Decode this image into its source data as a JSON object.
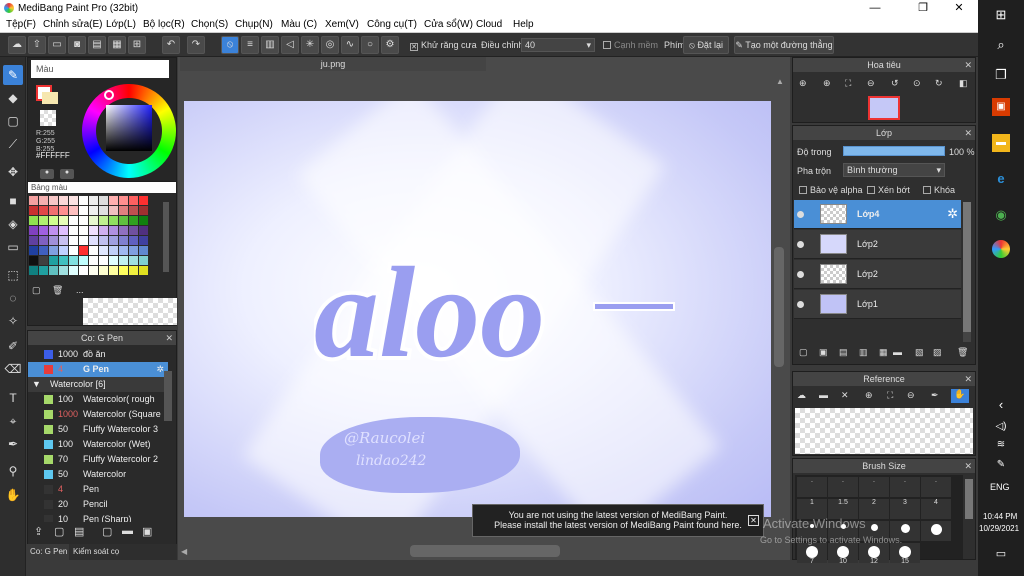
{
  "window": {
    "title": "MediBang Paint Pro (32bit)",
    "min": "—",
    "max": "❐",
    "close": "✕"
  },
  "menu": [
    "Tệp(F)",
    "Chỉnh sửa(E)",
    "Lớp(L)",
    "Bộ lọc(R)",
    "Chọn(S)",
    "Chụp(N)",
    "Màu (C)",
    "Xem(V)",
    "Công cụ(T)",
    "Cửa sổ(W)",
    "Cloud",
    "Help"
  ],
  "toolbar": {
    "antialias": "Khử răng cưa",
    "correction": "Điều chỉnh",
    "correction_value": "40",
    "soft_edge": "Cạnh mềm",
    "key": "Phím",
    "reset": "Đặt lại",
    "straight": "Tạo một đường thẳng"
  },
  "color_panel": {
    "title": "Màu",
    "r": "R:255",
    "g": "G:255",
    "b": "B:255",
    "hex": "#FFFFFF",
    "palette_title": "Bảng màu",
    "palette_more": "..."
  },
  "canvas": {
    "tab": "ju.png",
    "art_text": "aloo",
    "signature_line1": "@Raucolei",
    "signature_line2": "lindao242"
  },
  "brush_list": {
    "title": "Co: G Pen",
    "rows": [
      {
        "size": "1000",
        "name": "đồ ăn",
        "color": "#3c5ee8",
        "sel": false
      },
      {
        "size": "4",
        "name": "G Pen",
        "color": "#e63c3c",
        "sel": true
      },
      {
        "group": "Watercolor [6]"
      },
      {
        "size": "100",
        "name": "Watercolor( rough",
        "color": "#a6d96a"
      },
      {
        "size": "1000",
        "name": "Watercolor (Square",
        "color": "#a6d96a"
      },
      {
        "size": "50",
        "name": "Fluffy Watercolor 3",
        "color": "#a6d96a"
      },
      {
        "size": "100",
        "name": "Watercolor (Wet)",
        "color": "#5ec8f0"
      },
      {
        "size": "70",
        "name": "Fluffy Watercolor 2",
        "color": "#a6d96a"
      },
      {
        "size": "50",
        "name": "Watercolor",
        "color": "#5ec8f0"
      },
      {
        "size": "4",
        "name": "Pen",
        "color": "#333"
      },
      {
        "size": "20",
        "name": "Pencil",
        "color": "#333"
      },
      {
        "size": "10",
        "name": "Pen (Sharp)",
        "color": "#333"
      }
    ],
    "tab1": "Co: G Pen",
    "tab2": "Kiểm soát cọ"
  },
  "navigator": {
    "title": "Hoa tiêu"
  },
  "layers": {
    "title": "Lớp",
    "opacity_label": "Độ trong",
    "opacity_value": "100 %",
    "blend_label": "Pha trộn",
    "blend_value": "Bình thường",
    "protect_alpha": "Bảo vệ alpha",
    "clipping": "Xén bớt",
    "lock": "Khóa",
    "items": [
      {
        "name": "Lớp4",
        "sel": true
      },
      {
        "name": "Lớp2",
        "sel": false
      },
      {
        "name": "Lớp2",
        "sel": false
      },
      {
        "name": "Lớp1",
        "sel": false
      }
    ]
  },
  "reference": {
    "title": "Reference"
  },
  "brush_size": {
    "title": "Brush Size",
    "row1": [
      ".",
      ".",
      ".",
      ".",
      "."
    ],
    "row2": [
      "1",
      "1.5",
      "2",
      "3",
      "4"
    ],
    "row3": [
      "",
      "",
      "",
      "",
      ""
    ],
    "row4": [
      "7",
      "10",
      "12",
      "15"
    ]
  },
  "notice": {
    "line1": "You are not using the latest version of MediBang Paint.",
    "line2": "Please install the latest version of MediBang Paint found here."
  },
  "watermark": {
    "line1": "Activate Windows",
    "line2": "Go to Settings to activate Windows."
  },
  "taskbar": {
    "lang": "ENG",
    "time": "10:44 PM",
    "date": "10/29/2021"
  }
}
